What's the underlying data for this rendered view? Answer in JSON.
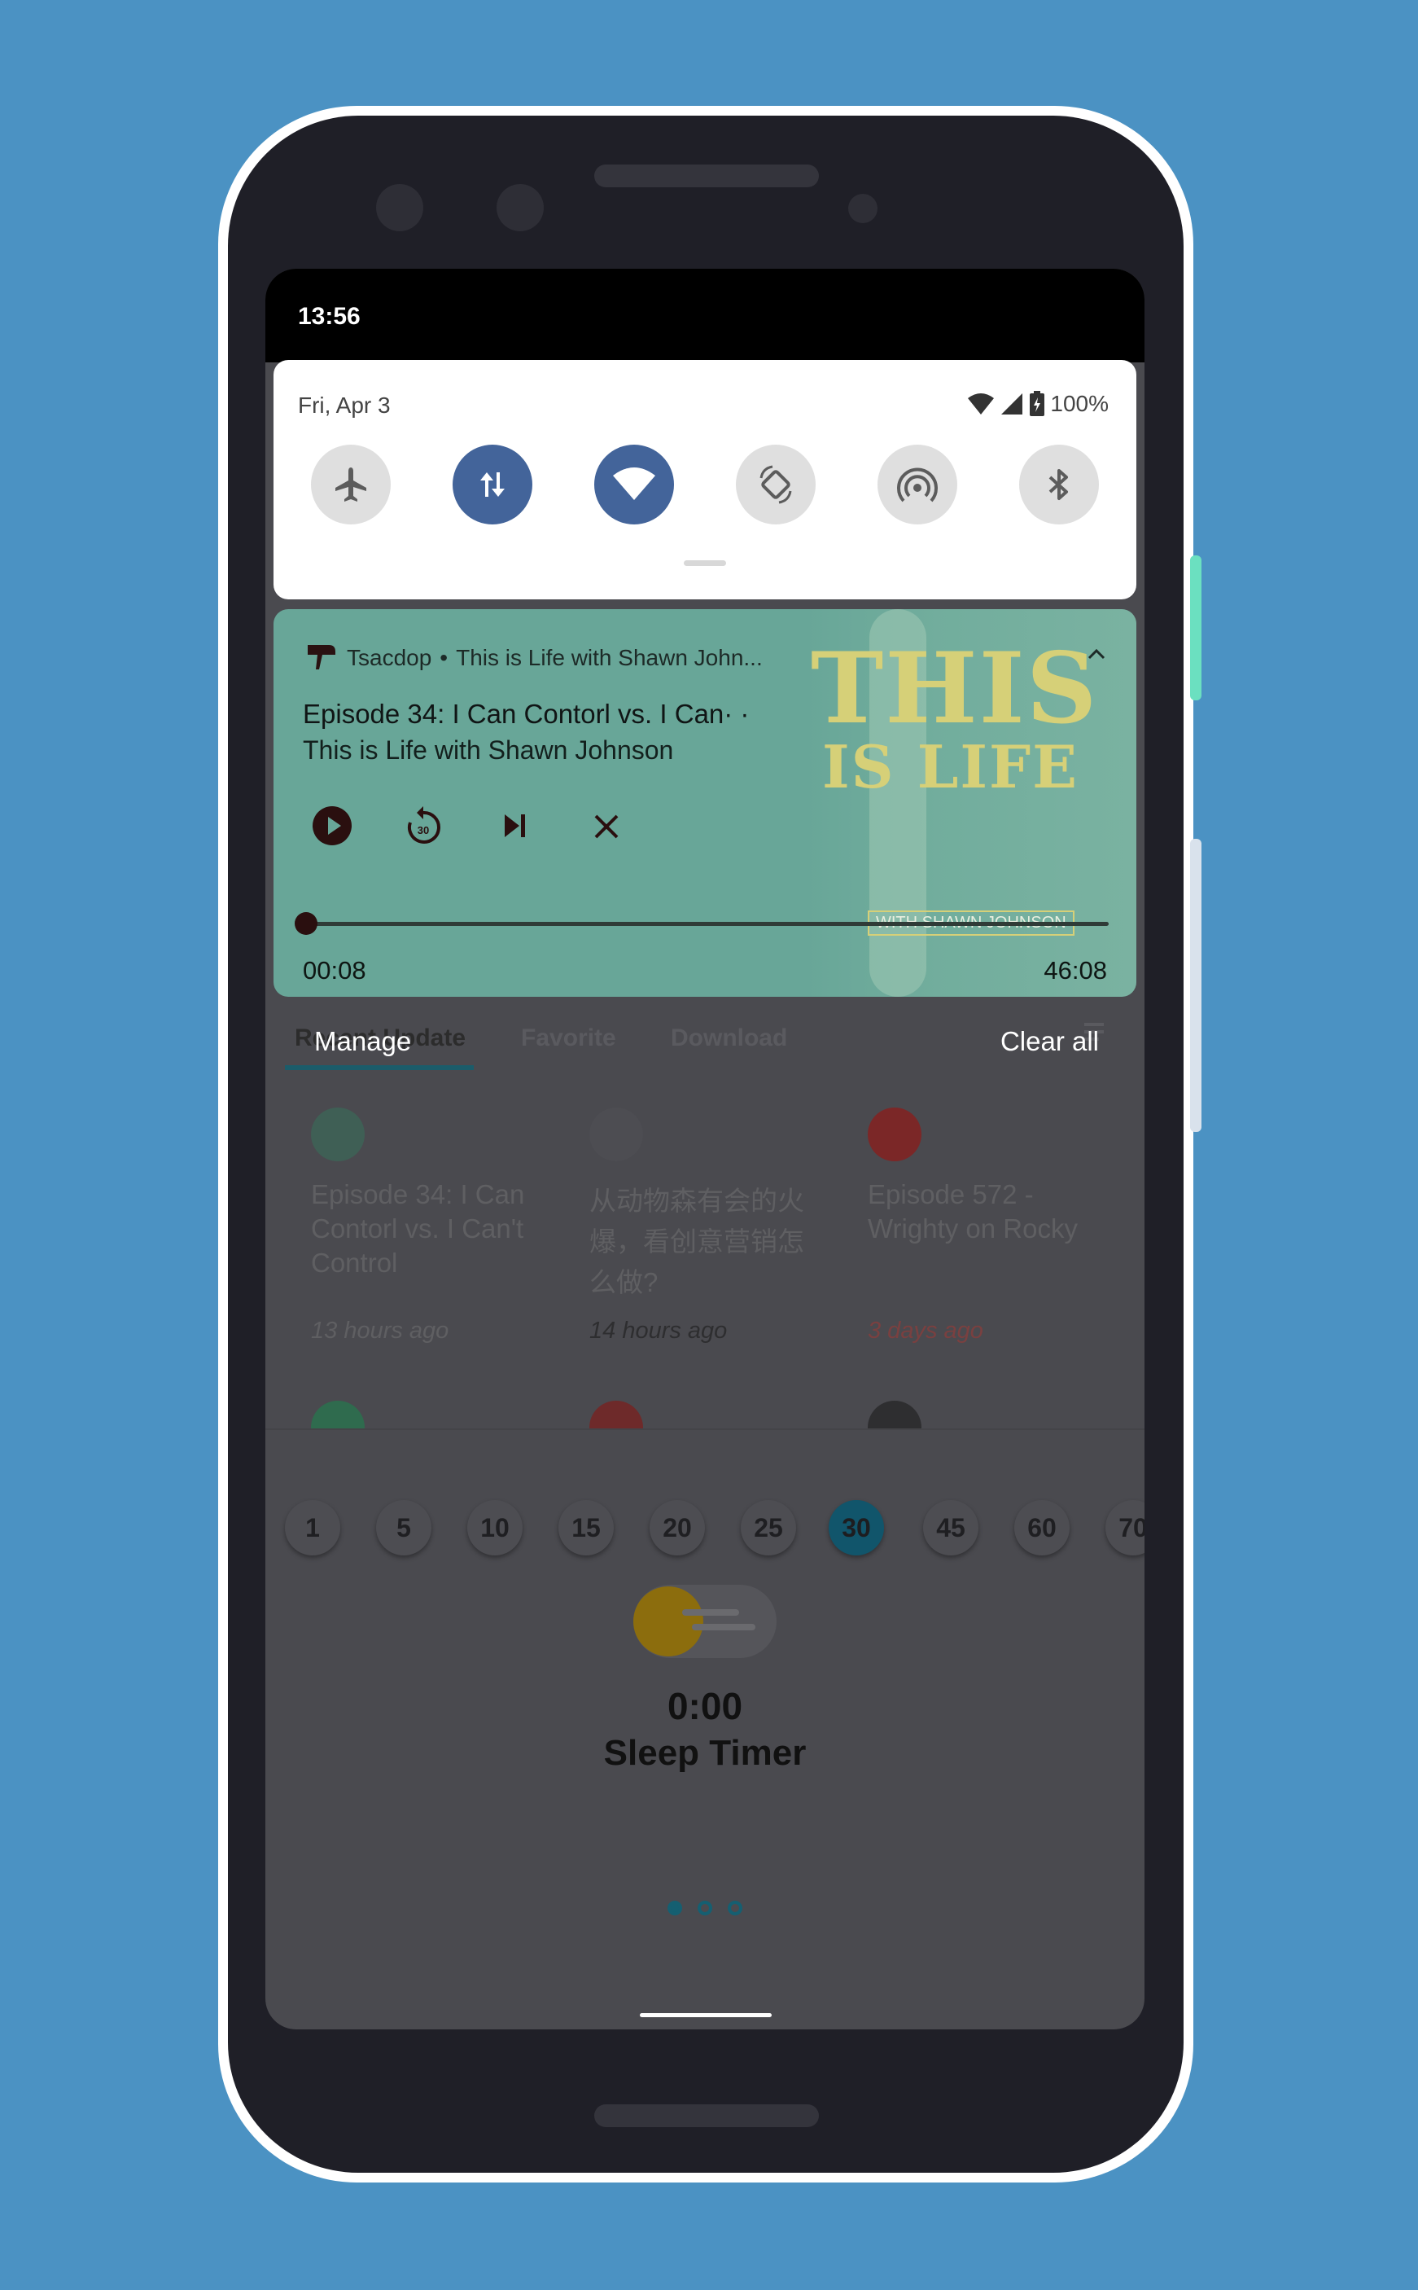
{
  "status_bar": {
    "time": "13:56"
  },
  "quick_settings": {
    "date": "Fri, Apr 3",
    "battery": "100%",
    "tiles": [
      {
        "name": "airplane-mode",
        "icon": "airplane-icon",
        "active": false
      },
      {
        "name": "mobile-data",
        "icon": "data-transfer-icon",
        "active": true
      },
      {
        "name": "wifi",
        "icon": "wifi-icon",
        "active": true
      },
      {
        "name": "auto-rotate",
        "icon": "rotate-icon",
        "active": false
      },
      {
        "name": "hotspot",
        "icon": "hotspot-icon",
        "active": false
      },
      {
        "name": "bluetooth",
        "icon": "bluetooth-icon",
        "active": false
      }
    ]
  },
  "media_notification": {
    "app_name": "Tsacdop",
    "separator": "•",
    "subtitle": "This is Life with Shawn John...",
    "episode_title": "Episode 34: I Can Contorl vs. I Can· ·",
    "artist": "This is Life with Shawn Johnson",
    "elapsed": "00:08",
    "duration": "46:08",
    "progress_fraction": 0.003,
    "artwork": {
      "line1": "THIS",
      "line2": "IS LIFE",
      "line3": "WITH SHAWN JOHNSON"
    },
    "accent_color": "#68a698"
  },
  "shade_actions": {
    "manage": "Manage",
    "clear_all": "Clear all"
  },
  "app": {
    "tabs": [
      {
        "label": "Recent Update",
        "active": true
      },
      {
        "label": "Favorite",
        "active": false
      },
      {
        "label": "Download",
        "active": false
      }
    ],
    "episodes": [
      {
        "title": "Episode 34: I Can Contorl vs. I Can't Control",
        "time": "13 hours ago",
        "thumb_color": "#3f5f55"
      },
      {
        "title": "从动物森有会的火爆，看创意营销怎么做?",
        "time": "14 hours ago",
        "thumb_color": "#4d4d52"
      },
      {
        "title": "Episode 572 - Wrighty on Rocky",
        "time": "3 days ago",
        "thumb_color": "#7b2727"
      }
    ],
    "sleep_timer": {
      "options": [
        "1",
        "5",
        "10",
        "15",
        "20",
        "25",
        "30",
        "45",
        "60",
        "70"
      ],
      "selected": "30",
      "value": "0:00",
      "label": "Sleep Timer"
    }
  }
}
